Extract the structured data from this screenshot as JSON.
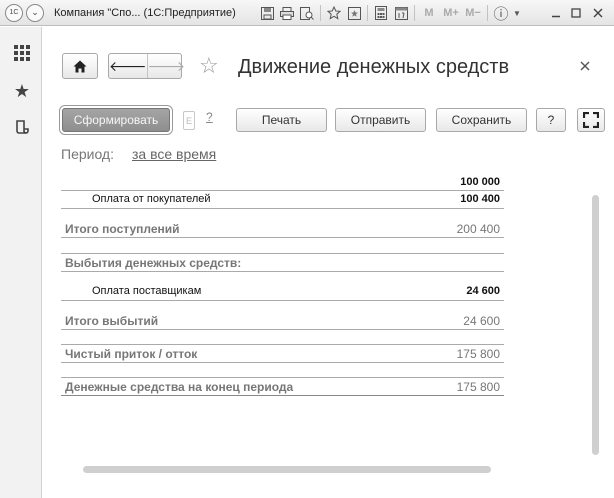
{
  "window": {
    "title": "Компания \"Спо...  (1С:Предприятие)",
    "toolbar_memory": [
      "M",
      "M+",
      "M−"
    ]
  },
  "form": {
    "title": "Движение денежных средств"
  },
  "commands": {
    "generate": "Сформировать",
    "mini_box": "E",
    "mini_help": "?",
    "print": "Печать",
    "send": "Отправить",
    "save": "Сохранить",
    "help": "?"
  },
  "period": {
    "label": "Период:",
    "value": "за все время"
  },
  "report": {
    "rows": [
      {
        "label": "",
        "value": "100 000",
        "indent": false,
        "bold": true,
        "muted": false
      },
      {
        "label": "Оплата от покупателей",
        "value": "100 400",
        "indent": true,
        "bold": false,
        "muted": false
      },
      {
        "label": "Итого поступлений",
        "value": "200 400",
        "indent": false,
        "bold": true,
        "muted": true
      },
      {
        "label": "Выбытия денежных средств:",
        "value": "",
        "indent": false,
        "bold": true,
        "muted": true
      },
      {
        "label": "Оплата поставщикам",
        "value": "24 600",
        "indent": true,
        "bold": false,
        "muted": false
      },
      {
        "label": "Итого выбытий",
        "value": "24 600",
        "indent": false,
        "bold": true,
        "muted": true
      },
      {
        "label": "Чистый приток / отток",
        "value": "175 800",
        "indent": false,
        "bold": true,
        "muted": true
      },
      {
        "label": "Денежные средства на конец периода",
        "value": "175 800",
        "indent": false,
        "bold": true,
        "muted": true
      }
    ]
  },
  "icons": {
    "app_menu": "1C",
    "dropdown": "⌄",
    "home": "home-icon",
    "favorite": "☆",
    "info": "ⓘ"
  }
}
